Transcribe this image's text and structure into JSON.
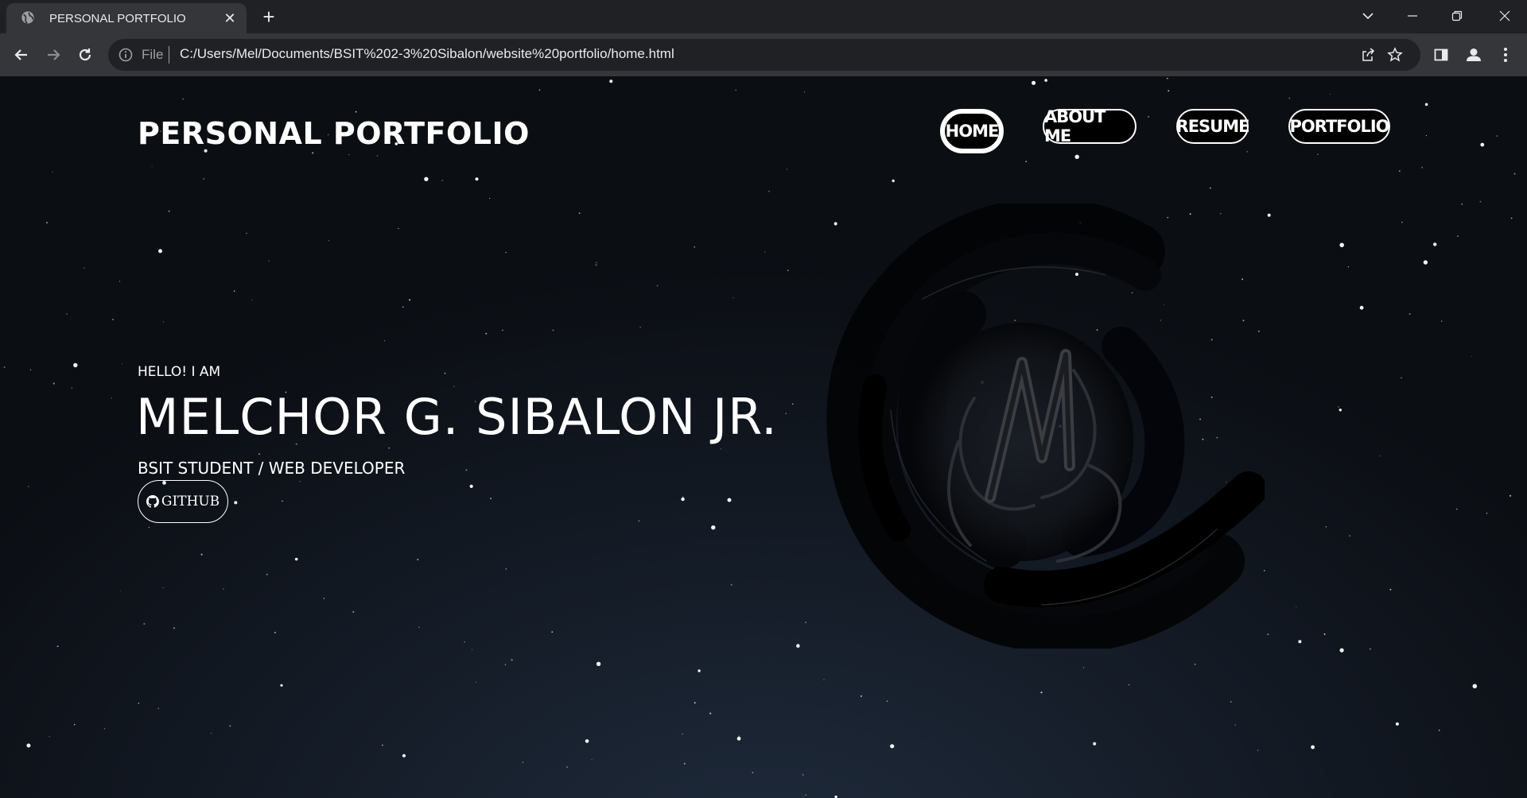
{
  "browser": {
    "tab_title": "PERSONAL PORTFOLIO",
    "tab_close": "✕",
    "new_tab": "+",
    "address_prefix": "File",
    "address_url": "C:/Users/Mel/Documents/BSIT%202-3%20Sibalon/website%20portfolio/home.html",
    "icons": [
      "globe-icon",
      "back-icon",
      "forward-icon",
      "reload-icon",
      "info-icon",
      "share-icon",
      "star-icon",
      "side-panel-icon",
      "profile-icon",
      "menu-icon",
      "tab-search-icon",
      "minimize-icon",
      "restore-icon",
      "close-icon"
    ]
  },
  "page": {
    "site_title": "PERSONAL PORTFOLIO",
    "nav": [
      {
        "label": "HOME",
        "active": true
      },
      {
        "label": "ABOUT ME",
        "active": false
      },
      {
        "label": "RESUME",
        "active": false
      },
      {
        "label": "PORTFOLIO",
        "active": false
      }
    ],
    "greeting": "HELLO! I AM",
    "name": "MELCHOR G. SIBALON JR.",
    "role": "BSIT STUDENT / WEB DEVELOPER",
    "github_label": "GITHUB",
    "colors": {
      "text": "#ffffff",
      "background_top": "#0b0e13",
      "background_glow": "#1f2b3c",
      "chrome_dark": "#202124",
      "chrome_light": "#35363a"
    }
  }
}
